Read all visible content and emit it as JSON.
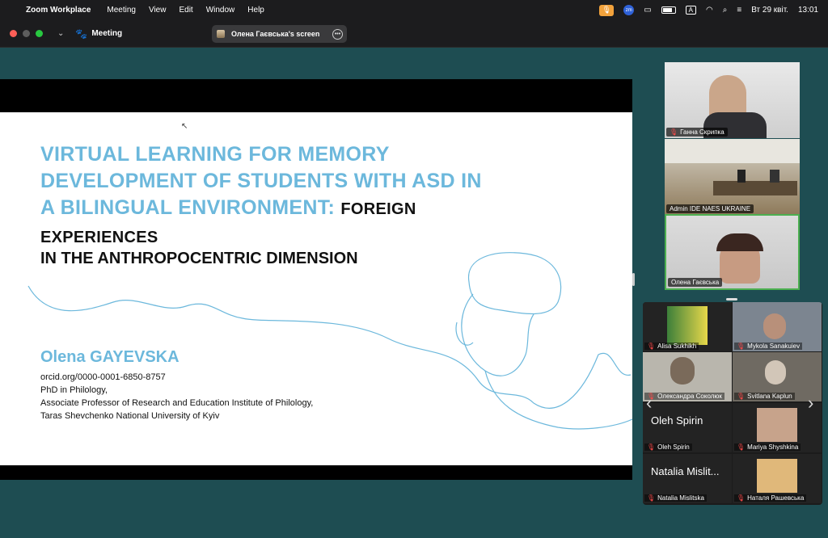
{
  "menubar": {
    "apple_icon": "apple-logo-icon",
    "app_name": "Zoom Workplace",
    "items": [
      "Meeting",
      "View",
      "Edit",
      "Window",
      "Help"
    ],
    "status": {
      "zm": "zm",
      "input_mode": "A",
      "date": "Вт 29 квіт.",
      "time": "13:01"
    }
  },
  "zoombar": {
    "meeting_label": "Meeting",
    "screen_pill": "Олена Гаєвська's screen"
  },
  "slide": {
    "title_blue": "VIRTUAL LEARNING FOR MEMORY DEVELOPMENT OF STUDENTS WITH ASD IN A BILINGUAL ENVIRONMENT:",
    "title_dark": "FOREIGN EXPERIENCES",
    "subtitle": "IN THE ANTHROPOCENTRIC DIMENSION",
    "author": "Olena GAYEVSKA",
    "orcid": "orcid.org/0000-0001-6850-8757",
    "degree": "PhD in Philology,",
    "position": "Associate Professor of Research and Education Institute of Philology,",
    "university": "Taras Shevchenko National University of Kyiv"
  },
  "videos": [
    {
      "name": "Ганна Скрипка"
    },
    {
      "name": "Admin IDE NAES UKRAINE"
    },
    {
      "name": "Олена Гаєвська"
    }
  ],
  "gallery": [
    {
      "name": "Alisa Sukhikh"
    },
    {
      "name": "Mykola Sanakuiev"
    },
    {
      "name": "Олександра Соколюк"
    },
    {
      "name": "Svitlana Kaplun"
    },
    {
      "name": "Oleh Spirin",
      "big": "Oleh Spirin"
    },
    {
      "name": "Mariya Shyshkina"
    },
    {
      "name": "Natalia Mislitska",
      "big": "Natalia Mislit..."
    },
    {
      "name": "Наталя Рашевська"
    }
  ],
  "colors": {
    "accent_blue": "#6cb8dc",
    "bg": "#1e4d52",
    "active": "#4caf50"
  }
}
